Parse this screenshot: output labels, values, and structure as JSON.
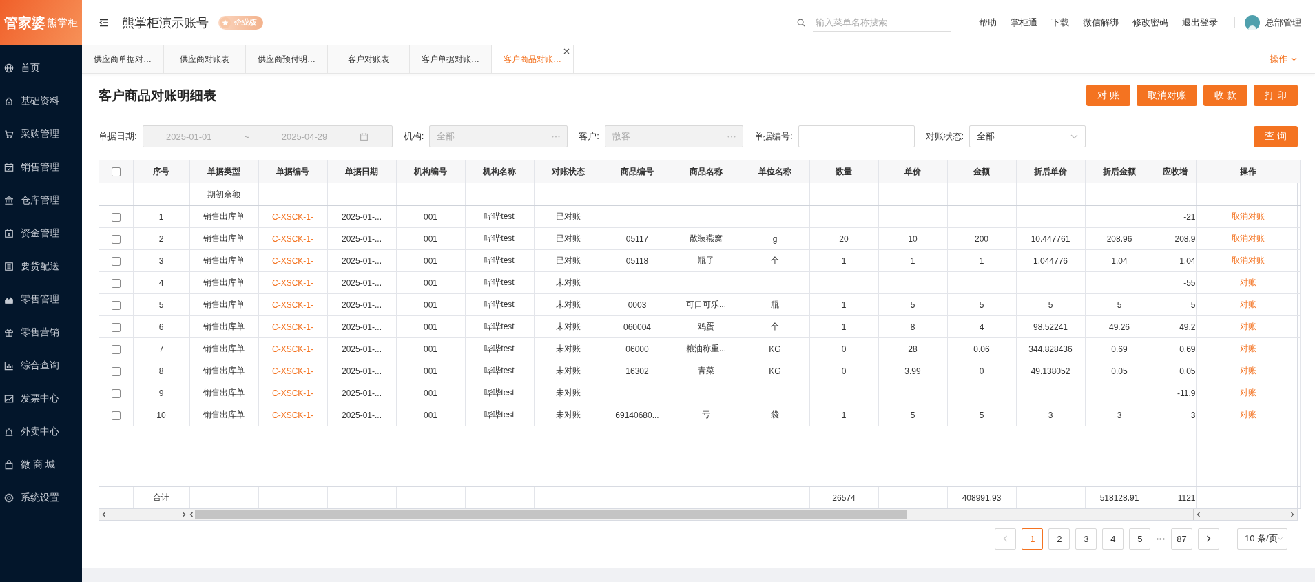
{
  "sidebar": {
    "logo": {
      "brand": "管家婆",
      "product": "熊掌柜"
    },
    "items": [
      {
        "label": "首页"
      },
      {
        "label": "基础资料"
      },
      {
        "label": "采购管理"
      },
      {
        "label": "销售管理"
      },
      {
        "label": "仓库管理"
      },
      {
        "label": "资金管理"
      },
      {
        "label": "要货配送"
      },
      {
        "label": "零售管理"
      },
      {
        "label": "零售营销"
      },
      {
        "label": "综合查询"
      },
      {
        "label": "发票中心"
      },
      {
        "label": "外卖中心"
      },
      {
        "label": "微 商 城"
      },
      {
        "label": "系统设置"
      }
    ]
  },
  "header": {
    "account": "熊掌柜演示账号",
    "edition_badge": "企业版",
    "search": {
      "placeholder": "输入菜单名称搜索"
    },
    "links": [
      "帮助",
      "掌柜通",
      "下载",
      "微信解绑",
      "修改密码",
      "退出登录"
    ],
    "user": "总部管理"
  },
  "tabs": {
    "items": [
      {
        "label": "供应商单据对…",
        "selected": false,
        "closable": false
      },
      {
        "label": "供应商对账表",
        "selected": false,
        "closable": false
      },
      {
        "label": "供应商预付明…",
        "selected": false,
        "closable": false
      },
      {
        "label": "客户对账表",
        "selected": false,
        "closable": false
      },
      {
        "label": "客户单据对账…",
        "selected": false,
        "closable": false
      },
      {
        "label": "客户商品对账…",
        "selected": true,
        "closable": true
      }
    ],
    "actions_menu": "操作"
  },
  "page": {
    "title": "客户商品对账明细表",
    "buttons": [
      "对 账",
      "取消对账",
      "收 款",
      "打 印"
    ]
  },
  "filters": {
    "fields": [
      {
        "kind": "date_range",
        "label": "单据日期:",
        "start": "2025-01-01",
        "separator": "~",
        "end": "2025-04-29",
        "disabled": true
      },
      {
        "kind": "picker",
        "label": "机构:",
        "value": "全部",
        "disabled": true
      },
      {
        "kind": "picker",
        "label": "客户:",
        "value": "散客",
        "disabled": true
      },
      {
        "kind": "input",
        "label": "单据编号:",
        "disabled": false
      },
      {
        "kind": "select",
        "label": "对账状态:",
        "value": "全部",
        "disabled": false
      }
    ],
    "query_button": "查 询"
  },
  "table": {
    "all_checked": false,
    "columns": [
      {
        "label": "序号",
        "kind": "text"
      },
      {
        "label": "单据类型",
        "kind": "text"
      },
      {
        "label": "单据编号",
        "kind": "link"
      },
      {
        "label": "单据日期",
        "kind": "text"
      },
      {
        "label": "机构编号",
        "kind": "text"
      },
      {
        "label": "机构名称",
        "kind": "text"
      },
      {
        "label": "对账状态",
        "kind": "text"
      },
      {
        "label": "商品编号",
        "kind": "text"
      },
      {
        "label": "商品名称",
        "kind": "text"
      },
      {
        "label": "单位名称",
        "kind": "text"
      },
      {
        "label": "数量",
        "kind": "text"
      },
      {
        "label": "单价",
        "kind": "text"
      },
      {
        "label": "金额",
        "kind": "text"
      },
      {
        "label": "折后单价",
        "kind": "text"
      },
      {
        "label": "折后金额",
        "kind": "text"
      },
      {
        "label": "应收增",
        "kind": "number"
      },
      {
        "label": "操作",
        "kind": "action"
      }
    ],
    "rows": [
      {
        "kind": "opening",
        "cells": [
          null,
          "期初余额",
          null,
          null,
          null,
          null,
          null,
          null,
          null,
          null,
          null,
          null,
          null,
          null,
          null,
          null
        ]
      },
      {
        "kind": "entry",
        "checked": false,
        "cells": [
          "1",
          "销售出库单",
          "C-XSCK-1-",
          "2025-01-...",
          "001",
          "哔哔test",
          "已对账",
          null,
          null,
          null,
          null,
          null,
          null,
          null,
          null,
          "-21"
        ],
        "action": "取消对账"
      },
      {
        "kind": "entry",
        "checked": false,
        "cells": [
          "2",
          "销售出库单",
          "C-XSCK-1-",
          "2025-01-...",
          "001",
          "哔哔test",
          "已对账",
          "05117",
          "散装燕窝",
          "g",
          "20",
          "10",
          "200",
          "10.447761",
          "208.96",
          "208.9"
        ],
        "action": "取消对账"
      },
      {
        "kind": "entry",
        "checked": false,
        "cells": [
          "3",
          "销售出库单",
          "C-XSCK-1-",
          "2025-01-...",
          "001",
          "哔哔test",
          "已对账",
          "05118",
          "瓶子",
          "个",
          "1",
          "1",
          "1",
          "1.044776",
          "1.04",
          "1.04"
        ],
        "action": "取消对账"
      },
      {
        "kind": "entry",
        "checked": false,
        "cells": [
          "4",
          "销售出库单",
          "C-XSCK-1-",
          "2025-01-...",
          "001",
          "哔哔test",
          "未对账",
          null,
          null,
          null,
          null,
          null,
          null,
          null,
          null,
          "-55"
        ],
        "action": "对账"
      },
      {
        "kind": "entry",
        "checked": false,
        "cells": [
          "5",
          "销售出库单",
          "C-XSCK-1-",
          "2025-01-...",
          "001",
          "哔哔test",
          "未对账",
          "0003",
          "可口可乐...",
          "瓶",
          "1",
          "5",
          "5",
          "5",
          "5",
          "5"
        ],
        "action": "对账"
      },
      {
        "kind": "entry",
        "checked": false,
        "cells": [
          "6",
          "销售出库单",
          "C-XSCK-1-",
          "2025-01-...",
          "001",
          "哔哔test",
          "未对账",
          "060004",
          "鸡蛋",
          "个",
          "1",
          "8",
          "4",
          "98.52241",
          "49.26",
          "49.2"
        ],
        "action": "对账"
      },
      {
        "kind": "entry",
        "checked": false,
        "cells": [
          "7",
          "销售出库单",
          "C-XSCK-1-",
          "2025-01-...",
          "001",
          "哔哔test",
          "未对账",
          "06000",
          "粮油称重...",
          "KG",
          "0",
          "28",
          "0.06",
          "344.828436",
          "0.69",
          "0.69"
        ],
        "action": "对账"
      },
      {
        "kind": "entry",
        "checked": false,
        "cells": [
          "8",
          "销售出库单",
          "C-XSCK-1-",
          "2025-01-...",
          "001",
          "哔哔test",
          "未对账",
          "16302",
          "青菜",
          "KG",
          "0",
          "3.99",
          "0",
          "49.138052",
          "0.05",
          "0.05"
        ],
        "action": "对账"
      },
      {
        "kind": "entry",
        "checked": false,
        "cells": [
          "9",
          "销售出库单",
          "C-XSCK-1-",
          "2025-01-...",
          "001",
          "哔哔test",
          "未对账",
          null,
          null,
          null,
          null,
          null,
          null,
          null,
          null,
          "-11.9"
        ],
        "action": "对账"
      },
      {
        "kind": "entry",
        "checked": false,
        "cells": [
          "10",
          "销售出库单",
          "C-XSCK-1-",
          "2025-01-...",
          "001",
          "哔哔test",
          "未对账",
          "69140680...",
          "亏",
          "袋",
          "1",
          "5",
          "5",
          "3",
          "3",
          "3"
        ],
        "action": "对账"
      }
    ],
    "totals": {
      "cells": [
        "合计",
        null,
        null,
        null,
        null,
        null,
        null,
        null,
        null,
        null,
        "26574",
        null,
        "408991.93",
        null,
        "518128.91",
        "1121"
      ]
    }
  },
  "pagination": {
    "prev_disabled": true,
    "next_disabled": false,
    "pages": [
      {
        "label": "1",
        "selected": true
      },
      {
        "label": "2",
        "selected": false
      },
      {
        "label": "3",
        "selected": false
      },
      {
        "label": "4",
        "selected": false
      },
      {
        "label": "5",
        "selected": false
      },
      {
        "label": "87",
        "selected": false
      }
    ],
    "ellipsis": "•••",
    "page_size": "10 条/页"
  }
}
